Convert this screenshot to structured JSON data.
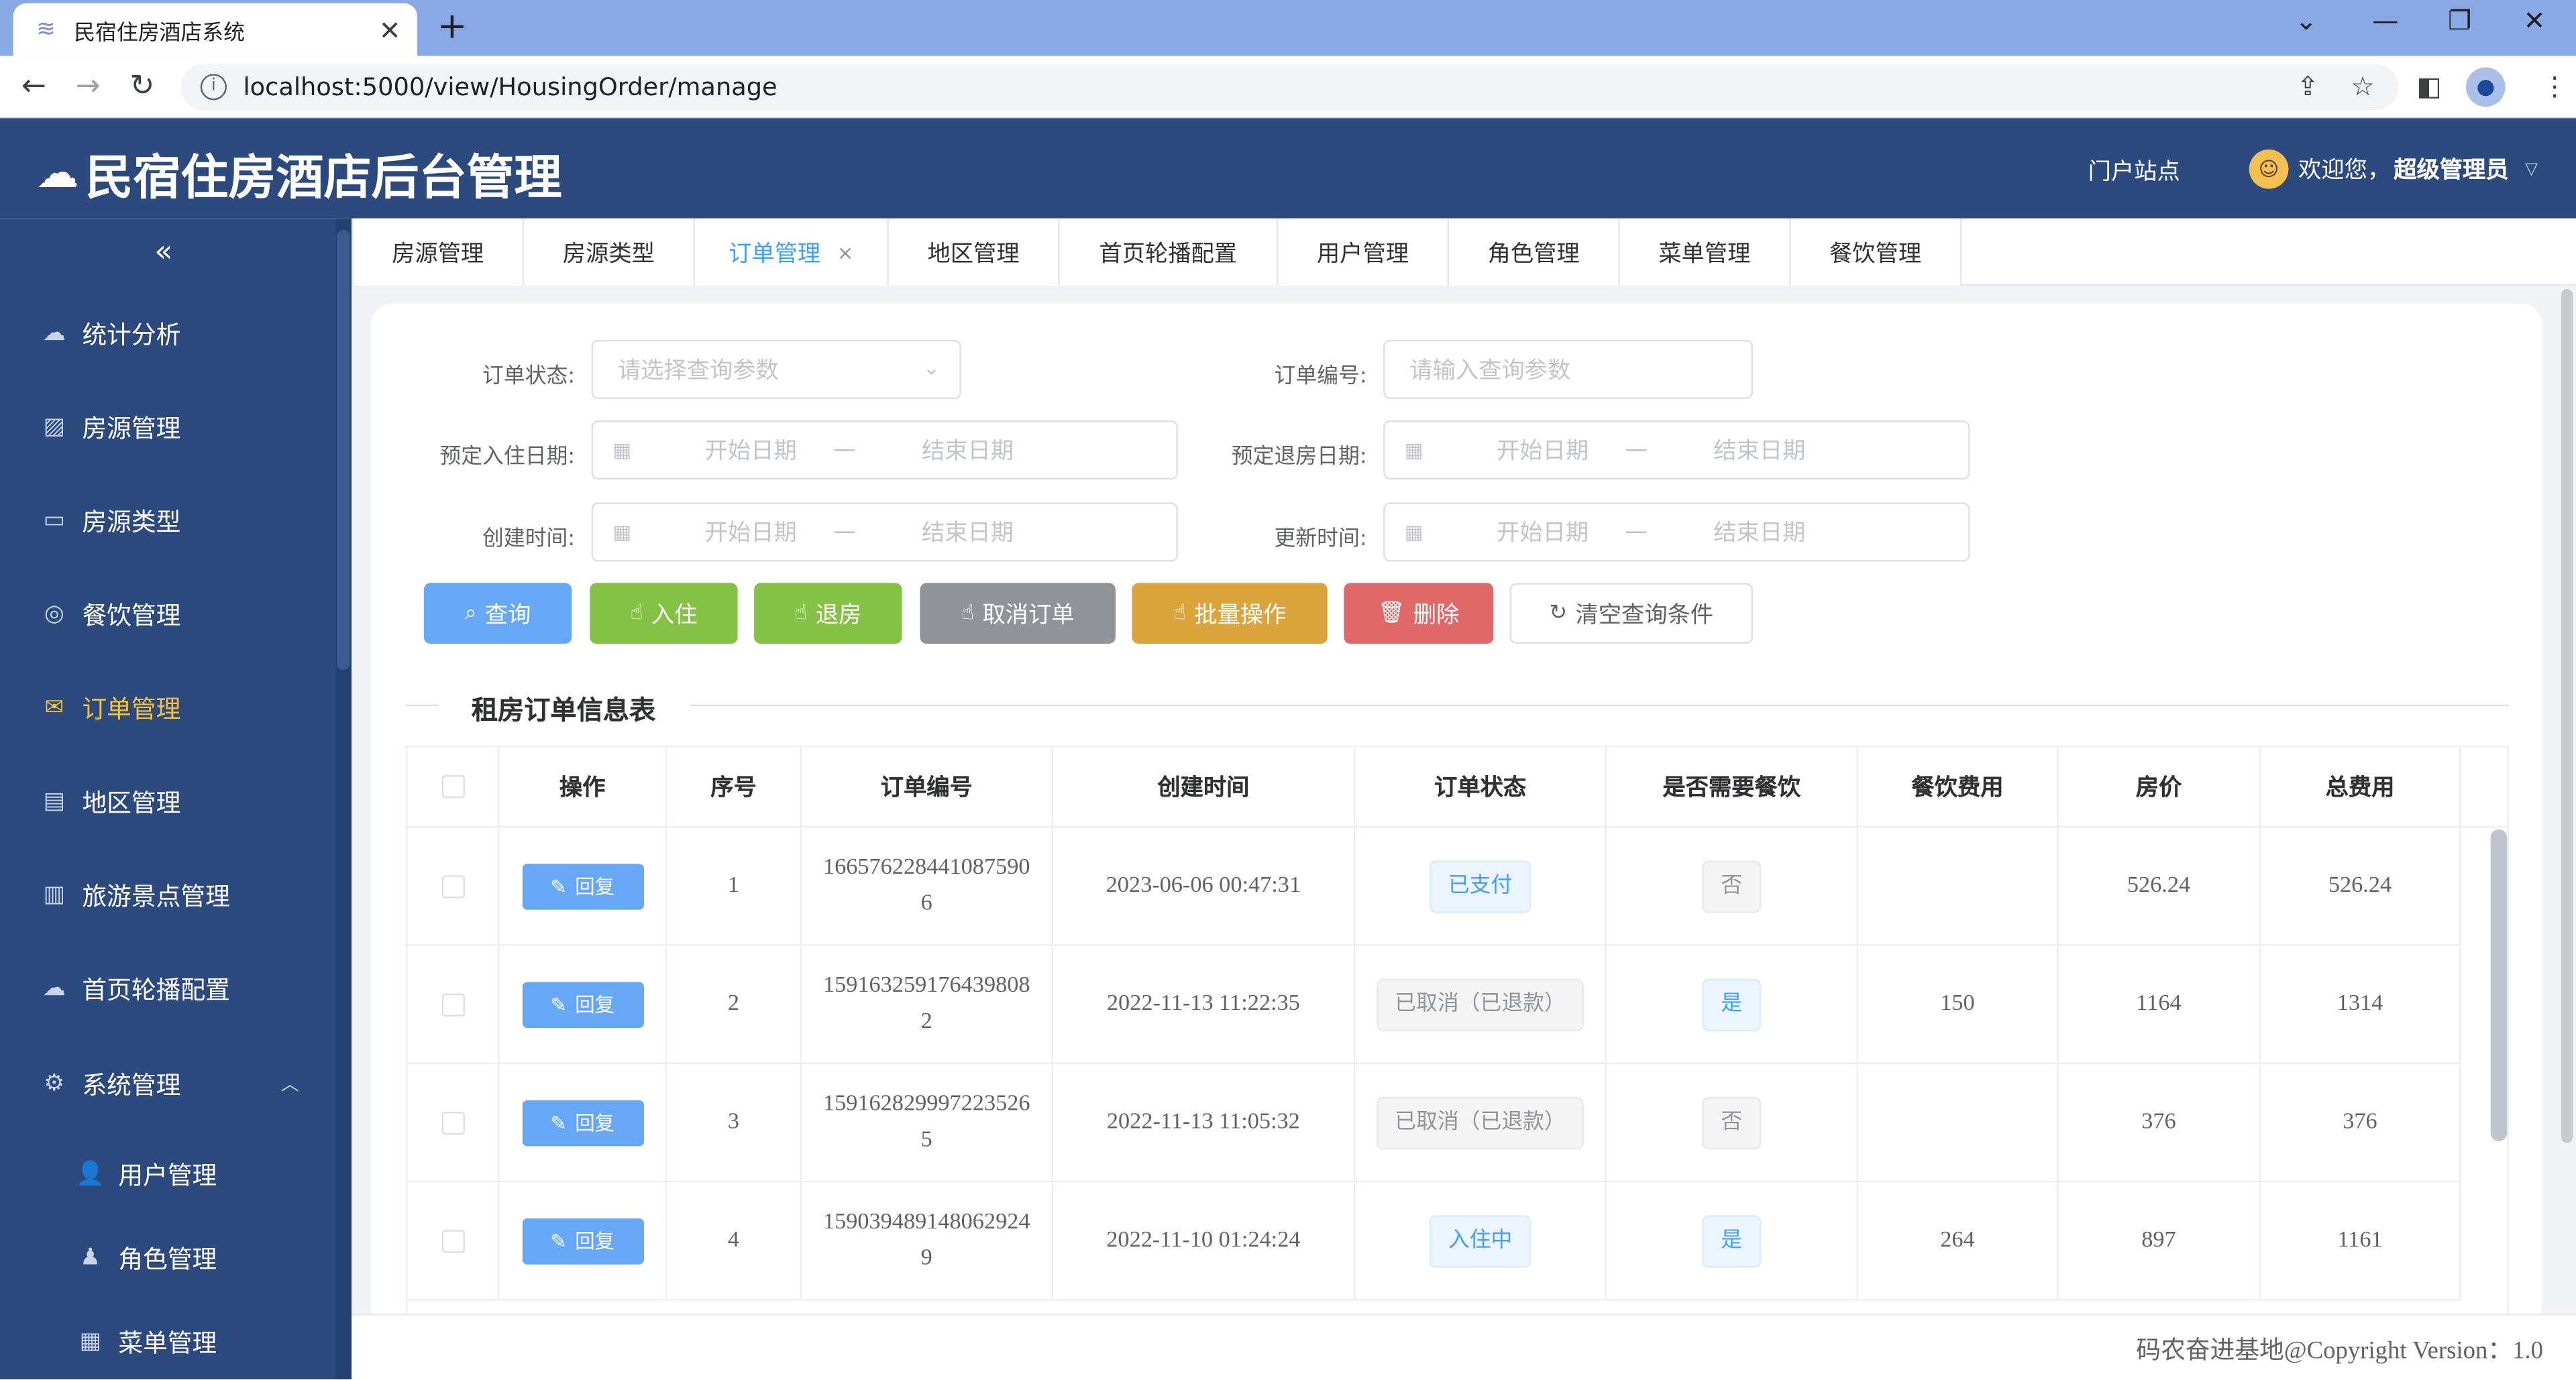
{
  "browser": {
    "tab_title": "民宿住房酒店系统",
    "url": "localhost:5000/view/HousingOrder/manage"
  },
  "app": {
    "title": "民宿住房酒店后台管理",
    "portal_link": "门户站点",
    "welcome_prefix": "欢迎您，",
    "user_name": "超级管理员"
  },
  "sidebar": {
    "items": [
      {
        "label": "统计分析",
        "icon": "cloud-icon"
      },
      {
        "label": "房源管理",
        "icon": "image-icon"
      },
      {
        "label": "房源类型",
        "icon": "board-icon"
      },
      {
        "label": "餐饮管理",
        "icon": "chat-icon"
      },
      {
        "label": "订单管理",
        "icon": "mail-icon",
        "active": true
      },
      {
        "label": "地区管理",
        "icon": "document-icon"
      },
      {
        "label": "旅游景点管理",
        "icon": "building-icon"
      },
      {
        "label": "首页轮播配置",
        "icon": "cloud-upload-icon"
      },
      {
        "label": "系统管理",
        "icon": "gear-icon",
        "expanded": true
      }
    ],
    "sub_items": [
      {
        "label": "用户管理",
        "icon": "user-icon"
      },
      {
        "label": "角色管理",
        "icon": "user-role-icon"
      },
      {
        "label": "菜单管理",
        "icon": "grid-icon"
      }
    ]
  },
  "tabs": [
    {
      "label": "房源管理"
    },
    {
      "label": "房源类型"
    },
    {
      "label": "订单管理",
      "active": true,
      "close": "×"
    },
    {
      "label": "地区管理"
    },
    {
      "label": "首页轮播配置"
    },
    {
      "label": "用户管理"
    },
    {
      "label": "角色管理"
    },
    {
      "label": "菜单管理"
    },
    {
      "label": "餐饮管理"
    }
  ],
  "filters": {
    "status_label": "订单状态:",
    "status_placeholder": "请选择查询参数",
    "order_no_label": "订单编号:",
    "order_no_placeholder": "请输入查询参数",
    "checkin_label": "预定入住日期:",
    "checkout_label": "预定退房日期:",
    "created_label": "创建时间:",
    "updated_label": "更新时间:",
    "start_date": "开始日期",
    "end_date": "结束日期",
    "range_sep": "—"
  },
  "buttons": {
    "query": "查询",
    "checkin": "入住",
    "checkout": "退房",
    "cancel": "取消订单",
    "batch": "批量操作",
    "delete": "删除",
    "clear": "清空查询条件",
    "colors": {
      "query": "#66a8f5",
      "checkin": "#85c145",
      "checkout": "#85c145",
      "cancel": "#909399",
      "batch": "#dca43c",
      "delete": "#e06868"
    }
  },
  "section_title": "租房订单信息表",
  "table": {
    "headers": [
      "操作",
      "序号",
      "订单编号",
      "创建时间",
      "订单状态",
      "是否需要餐饮",
      "餐饮费用",
      "房价",
      "总费用"
    ],
    "reply_label": "回复",
    "rows": [
      {
        "index": "1",
        "order_no": "1665762284410875906",
        "created": "2023-06-06 00:47:31",
        "status": "已支付",
        "status_style": "blue",
        "meal": "否",
        "meal_style": "gray",
        "meal_fee": "",
        "price": "526.24",
        "total": "526.24"
      },
      {
        "index": "2",
        "order_no": "1591632591764398082",
        "created": "2022-11-13 11:22:35",
        "status": "已取消（已退款）",
        "status_style": "gray",
        "meal": "是",
        "meal_style": "blue",
        "meal_fee": "150",
        "price": "1164",
        "total": "1314"
      },
      {
        "index": "3",
        "order_no": "1591628299972235265",
        "created": "2022-11-13 11:05:32",
        "status": "已取消（已退款）",
        "status_style": "gray",
        "meal": "否",
        "meal_style": "gray",
        "meal_fee": "",
        "price": "376",
        "total": "376"
      },
      {
        "index": "4",
        "order_no": "1590394891480629249",
        "created": "2022-11-10 01:24:24",
        "status": "入住中",
        "status_style": "blue",
        "meal": "是",
        "meal_style": "blue",
        "meal_fee": "264",
        "price": "897",
        "total": "1161"
      }
    ]
  },
  "footer": "码农奋进基地@Copyright Version：1.0"
}
